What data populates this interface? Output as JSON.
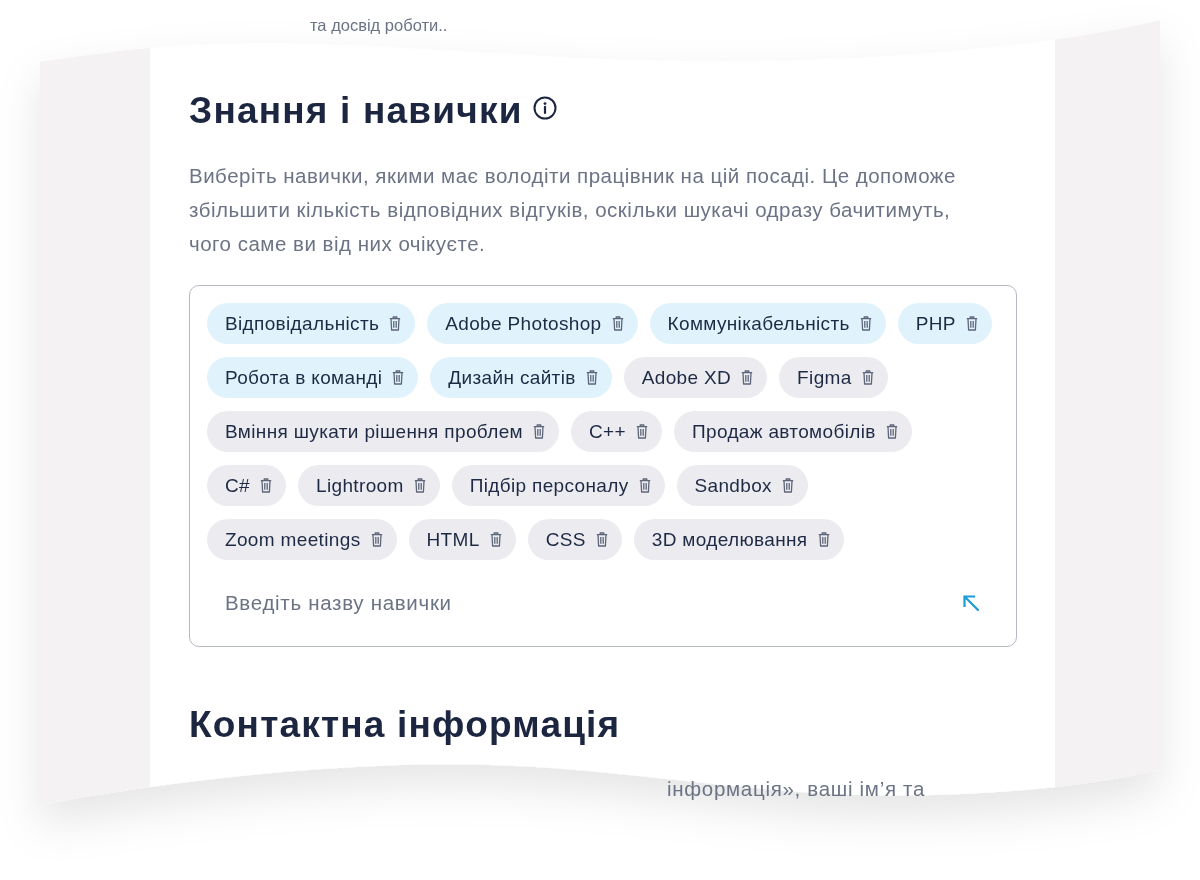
{
  "top_fragment": "та досвід роботи..",
  "skills_section": {
    "title": "Знання і навички",
    "description": "Виберіть навички, якими має володіти працівник на цій посаді. Це допоможе збільшити кількість відповідних відгуків, оскільки шукачі одразу бачитимуть, чого саме ви від них очікуєте.",
    "skills": [
      {
        "label": "Відповідальність",
        "selected": true
      },
      {
        "label": "Adobe Photoshop",
        "selected": true
      },
      {
        "label": "Коммунікабельність",
        "selected": true
      },
      {
        "label": "PHP",
        "selected": true
      },
      {
        "label": "Робота в команді",
        "selected": true
      },
      {
        "label": "Дизайн сайтів",
        "selected": true
      },
      {
        "label": "Adobe XD",
        "selected": false
      },
      {
        "label": "Figma",
        "selected": false
      },
      {
        "label": "Вміння шукати рішення проблем",
        "selected": false
      },
      {
        "label": "C++",
        "selected": false
      },
      {
        "label": "Продаж автомобілів",
        "selected": false
      },
      {
        "label": "C#",
        "selected": false
      },
      {
        "label": "Lightroom",
        "selected": false
      },
      {
        "label": "Підбір персоналу",
        "selected": false
      },
      {
        "label": "Sandbox",
        "selected": false
      },
      {
        "label": "Zoom meetings",
        "selected": false
      },
      {
        "label": "HTML",
        "selected": false
      },
      {
        "label": "CSS",
        "selected": false
      },
      {
        "label": "3D моделювання",
        "selected": false
      }
    ],
    "input": {
      "placeholder": "Введіть назву навички"
    }
  },
  "contacts_section": {
    "title": "Контактна інформація",
    "description_fragment": "інформація», ваші ім’я та"
  }
}
